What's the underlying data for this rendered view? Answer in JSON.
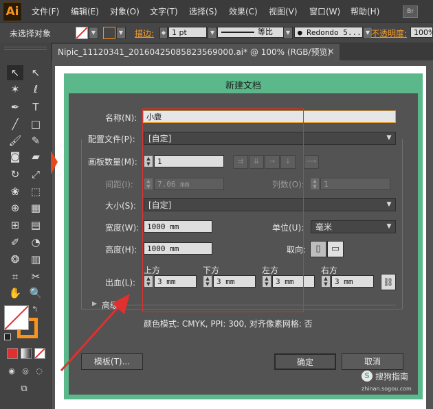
{
  "app": {
    "logo": "Ai",
    "br_button": "Br",
    "menu": [
      "文件(F)",
      "编辑(E)",
      "对象(O)",
      "文字(T)",
      "选择(S)",
      "效果(C)",
      "视图(V)",
      "窗口(W)",
      "帮助(H)"
    ]
  },
  "control_bar": {
    "selection": "未选择对象",
    "stroke_label": "描边:",
    "stroke_value": "1 pt",
    "uniform_label": "等比",
    "brush_name": "Redondo 5...",
    "opacity_label": "不透明度:",
    "opacity_value": "100%"
  },
  "document_tab": {
    "title": "Nipic_11120341_20160425085823569000.ai* @ 100% (RGB/预览)",
    "close": "×"
  },
  "dialog": {
    "title": "新建文档",
    "name_label": "名称(N):",
    "name_value": "小鹿",
    "profile_label": "配置文件(P):",
    "profile_value": "[自定]",
    "artboards_label": "画板数量(M):",
    "artboards_value": "1",
    "spacing_label": "间距(I):",
    "spacing_value": "7.06 mm",
    "columns_label": "列数(O):",
    "columns_value": "1",
    "size_label": "大小(S):",
    "size_value": "[自定]",
    "width_label": "宽度(W):",
    "width_value": "1000 mm",
    "units_label": "单位(U):",
    "units_value": "毫米",
    "height_label": "高度(H):",
    "height_value": "1000 mm",
    "orientation_label": "取向:",
    "bleed_label": "出血(L):",
    "bleed_top_label": "上方",
    "bleed_top_value": "3 mm",
    "bleed_bottom_label": "下方",
    "bleed_bottom_value": "3 mm",
    "bleed_left_label": "左方",
    "bleed_left_value": "3 mm",
    "bleed_right_label": "右方",
    "bleed_right_value": "3 mm",
    "advanced_label": "高级",
    "color_mode_info": "颜色模式: CMYK, PPI: 300, 对齐像素网格: 否",
    "templates_button": "模板(T)...",
    "ok_button": "确定",
    "cancel_button": "取消"
  },
  "watermark": {
    "text": "搜狗指南",
    "sub": "zhinan.sogou.com"
  },
  "colors": {
    "dialog_frame": "#5ab88a",
    "annotation_red": "#e03030",
    "brand_orange": "#f7931e"
  }
}
